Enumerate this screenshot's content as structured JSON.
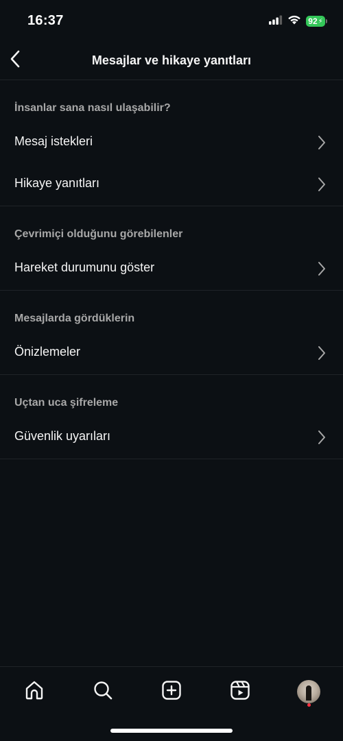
{
  "status_bar": {
    "time": "16:37",
    "battery": "92"
  },
  "header": {
    "title": "Mesajlar ve hikaye yanıtları"
  },
  "sections": [
    {
      "title": "İnsanlar sana nasıl ulaşabilir?",
      "items": [
        {
          "label": "Mesaj istekleri"
        },
        {
          "label": "Hikaye yanıtları"
        }
      ]
    },
    {
      "title": "Çevrimiçi olduğunu görebilenler",
      "items": [
        {
          "label": "Hareket durumunu göster"
        }
      ]
    },
    {
      "title": "Mesajlarda gördüklerin",
      "items": [
        {
          "label": "Önizlemeler"
        }
      ]
    },
    {
      "title": "Uçtan uca şifreleme",
      "items": [
        {
          "label": "Güvenlik uyarıları"
        }
      ]
    }
  ],
  "tab_bar": {
    "tabs": [
      {
        "icon": "home-icon"
      },
      {
        "icon": "search-icon"
      },
      {
        "icon": "create-icon"
      },
      {
        "icon": "reels-icon"
      },
      {
        "icon": "profile-avatar"
      }
    ]
  },
  "colors": {
    "background": "#0c1014",
    "text_primary": "#f5f5f5",
    "text_secondary": "#a8a8a8",
    "divider": "#1f2328",
    "battery": "#34c759",
    "notification": "#ff3040"
  }
}
